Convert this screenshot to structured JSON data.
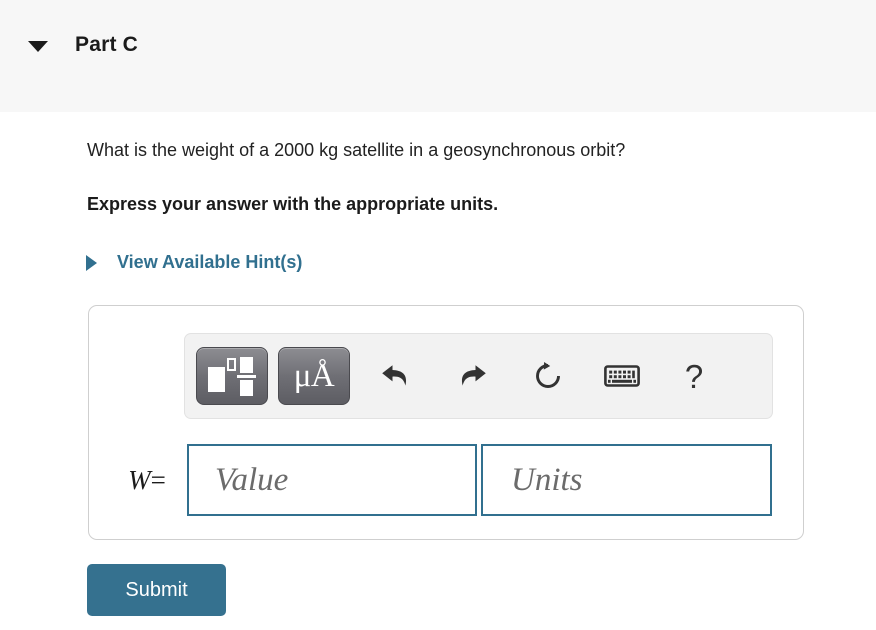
{
  "part": {
    "title": "Part C",
    "collapse_icon": "caret-down-icon",
    "expanded": true
  },
  "question": {
    "prompt": "What is the weight of a 2000 kg satellite in a geosynchronous orbit?",
    "instruction": "Express your answer with the appropriate units."
  },
  "hints": {
    "label": "View Available Hint(s)",
    "expand_icon": "caret-right-icon",
    "color": "#31708f"
  },
  "toolbar": {
    "buttons": [
      {
        "name": "math-template-button",
        "label": "",
        "icon": "math-template-icon"
      },
      {
        "name": "units-button",
        "label": "μÅ",
        "icon": "units-icon"
      }
    ],
    "icons": [
      {
        "name": "undo-icon",
        "label": "Undo"
      },
      {
        "name": "redo-icon",
        "label": "Redo"
      },
      {
        "name": "reset-icon",
        "label": "Reset"
      },
      {
        "name": "keyboard-icon",
        "label": "Keyboard shortcuts"
      },
      {
        "name": "help-icon",
        "label": "?"
      }
    ],
    "help_glyph": "?"
  },
  "answer": {
    "variable": "W",
    "equals": "=",
    "value_placeholder": "Value",
    "value_text": "",
    "units_placeholder": "Units",
    "units_text": "",
    "border_color": "#31708f"
  },
  "actions": {
    "submit_label": "Submit",
    "submit_color": "#35718f"
  }
}
